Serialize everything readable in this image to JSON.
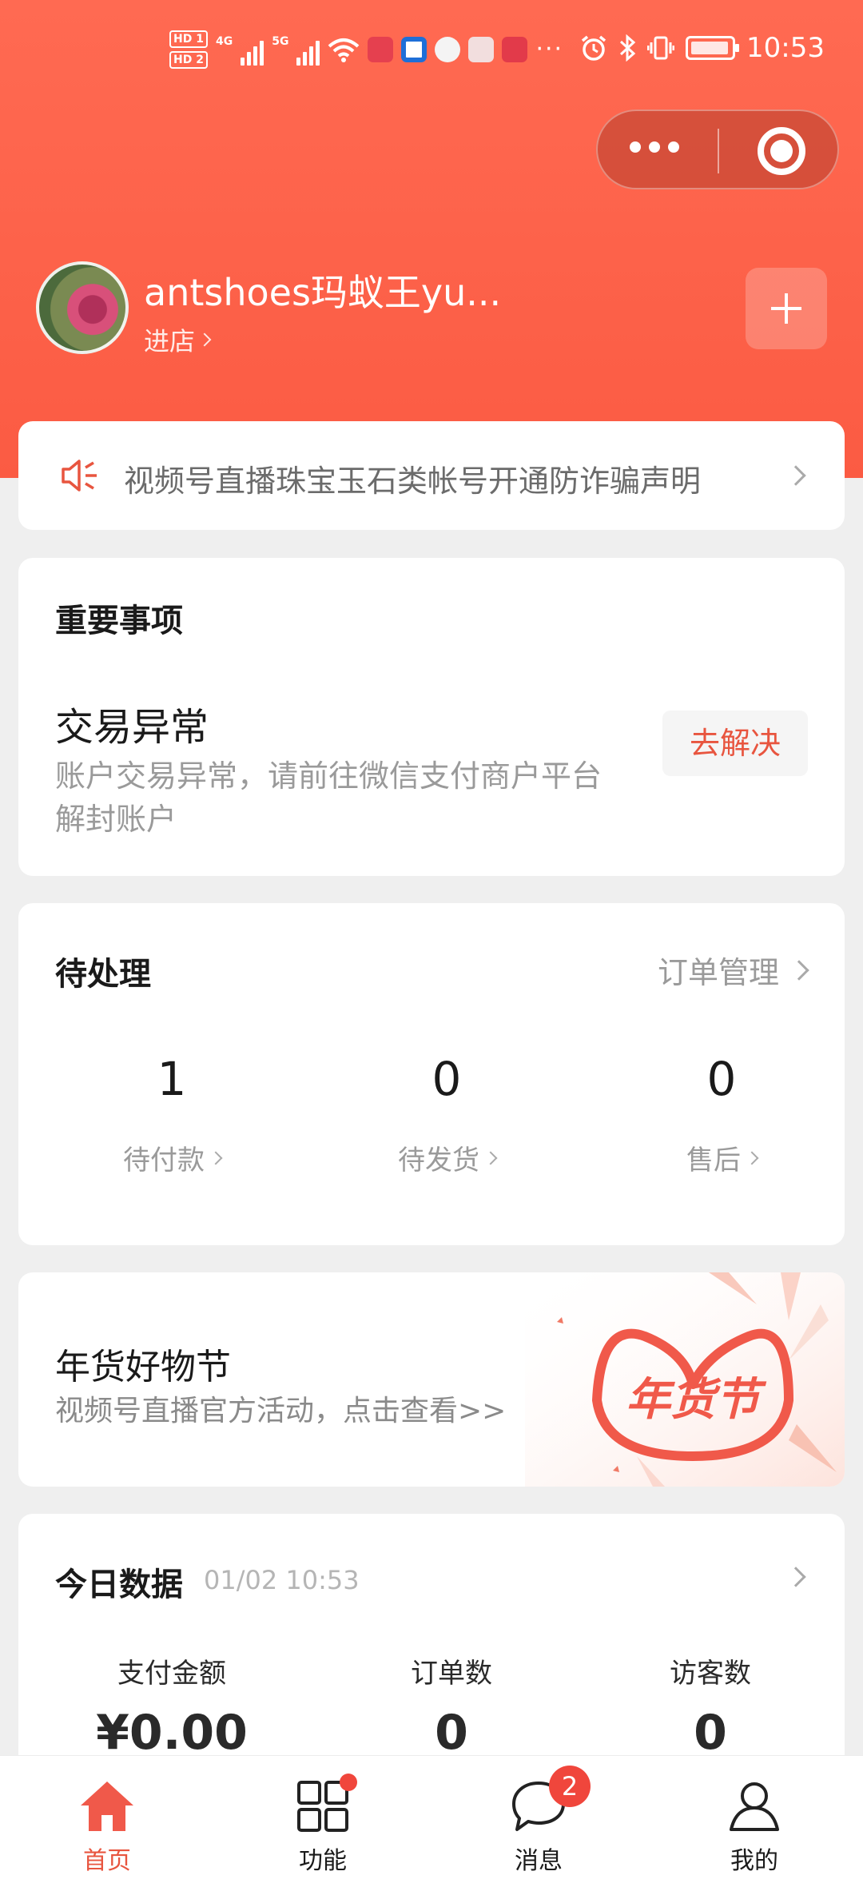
{
  "status_bar": {
    "hd1": "HD 1",
    "hd2": "HD 2",
    "net1": "4G",
    "net2": "5G",
    "time": "10:53",
    "app_icons": [
      "huawei-app-icon",
      "browser-app-icon",
      "ball-app-icon",
      "box-app-icon",
      "book-app-icon"
    ],
    "more": "···"
  },
  "header": {
    "shop_name": "antshoes玛蚁王yu...",
    "enter_shop": "进店"
  },
  "notice": {
    "text": "视频号直播珠宝玉石类帐号开通防诈骗声明"
  },
  "important": {
    "title": "重要事项",
    "issue_title": "交易异常",
    "issue_desc": "账户交易异常，请前往微信支付商户平台解封账户",
    "action": "去解决"
  },
  "pending": {
    "title": "待处理",
    "link": "订单管理",
    "stats": [
      {
        "value": "1",
        "label": "待付款"
      },
      {
        "value": "0",
        "label": "待发货"
      },
      {
        "value": "0",
        "label": "售后"
      }
    ]
  },
  "promo": {
    "title": "年货好物节",
    "subtitle": "视频号直播官方活动，点击查看>>",
    "art_text": "年货节"
  },
  "today": {
    "title": "今日数据",
    "time": "01/02 10:53",
    "metrics": [
      {
        "label": "支付金额",
        "value": "¥0.00"
      },
      {
        "label": "订单数",
        "value": "0"
      },
      {
        "label": "访客数",
        "value": "0"
      }
    ]
  },
  "tabbar": {
    "tabs": [
      {
        "label": "首页"
      },
      {
        "label": "功能"
      },
      {
        "label": "消息"
      },
      {
        "label": "我的"
      }
    ],
    "message_badge": "2"
  },
  "colors": {
    "brand": "#fb5b43",
    "accent_text": "#e8553f",
    "badge": "#f0463c"
  }
}
